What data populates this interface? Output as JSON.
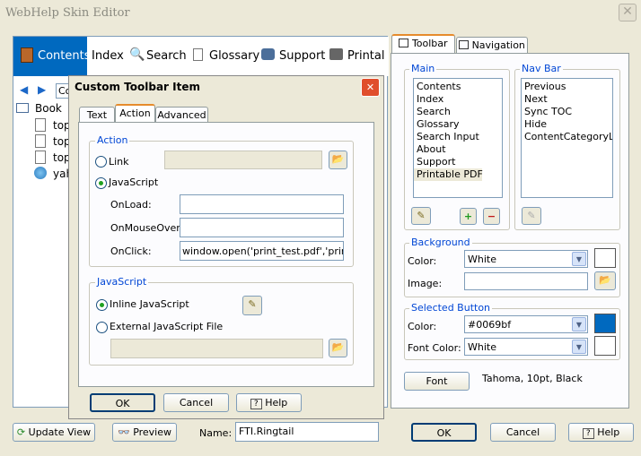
{
  "window": {
    "title": "WebHelp Skin Editor"
  },
  "preview": {
    "nav": [
      "Contents",
      "Index",
      "Search",
      "Glossary",
      "Support",
      "Printal"
    ],
    "tree_root": "Book",
    "tree_items": [
      "top",
      "top",
      "top",
      "yah"
    ],
    "search_stub": "Co"
  },
  "bottom_left": {
    "update_view": "Update View",
    "preview": "Preview",
    "name_label": "Name:",
    "name_value": "FTI.Ringtail"
  },
  "right_panel": {
    "tabs": [
      "Toolbar",
      "Navigation"
    ],
    "main_label": "Main",
    "main_items": [
      "Contents",
      "Index",
      "Search",
      "Glossary",
      "Search Input",
      "About",
      "Support",
      "Printable PDF"
    ],
    "main_selected_index": 7,
    "navbar_label": "Nav Bar",
    "navbar_items": [
      "Previous",
      "Next",
      "Sync TOC",
      "Hide",
      "ContentCategoryList"
    ],
    "background_label": "Background",
    "color_label": "Color:",
    "color_value": "White",
    "image_label": "Image:",
    "selected_label": "Selected Button",
    "sel_color_label": "Color:",
    "sel_color_value": "#0069bf",
    "font_color_label": "Font Color:",
    "font_color_value": "White",
    "font_button": "Font",
    "font_desc": "Tahoma, 10pt, Black",
    "ok": "OK",
    "cancel": "Cancel",
    "help": "Help"
  },
  "dialog": {
    "title": "Custom Toolbar Item",
    "tabs": [
      "Text",
      "Action",
      "Advanced"
    ],
    "action_label": "Action",
    "link_label": "Link",
    "javascript_label": "JavaScript",
    "onload_label": "OnLoad:",
    "onmouseover_label": "OnMouseOver:",
    "onclick_label": "OnClick:",
    "onclick_value": "window.open('print_test.pdf','printWin",
    "js_group_label": "JavaScript",
    "inline_label": "Inline JavaScript",
    "external_label": "External JavaScript File",
    "ok": "OK",
    "cancel": "Cancel",
    "help": "Help"
  },
  "colors": {
    "accent": "#0069bf",
    "group_label": "#0046d5"
  }
}
